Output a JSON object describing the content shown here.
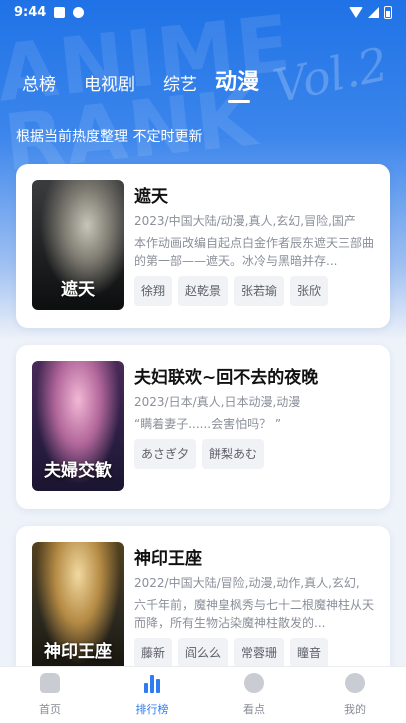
{
  "status_bar": {
    "time": "9:44"
  },
  "hero": {
    "watermark": "ANIME RANK",
    "script": "Vol.2"
  },
  "tabs": [
    {
      "label": "总榜"
    },
    {
      "label": "电视剧"
    },
    {
      "label": "综艺"
    },
    {
      "label": "动漫"
    }
  ],
  "active_tab": "动漫",
  "subtitle": "根据当前热度整理 不定时更新",
  "cards": [
    {
      "poster_title": "遮天",
      "title": "遮天",
      "meta": "2023/中国大陆/动漫,真人,玄幻,冒险,国产",
      "desc": "本作动画改编自起点白金作者辰东遮天三部曲的第一部——遮天。冰冷与黑暗并存...",
      "cast": [
        "徐翔",
        "赵乾景",
        "张若瑜",
        "张欣"
      ]
    },
    {
      "poster_title": "夫婦交歓",
      "title": "夫妇联欢~回不去的夜晚",
      "meta": "2023/日本/真人,日本动漫,动漫",
      "desc": "“瞒着妻子......会害怕吗？ ”",
      "cast": [
        "あさぎ夕",
        "餅梨あむ"
      ]
    },
    {
      "poster_title": "神印王座",
      "title": "神印王座",
      "meta": "2022/中国大陆/冒险,动漫,动作,真人,玄幻,",
      "desc": "六千年前，魔神皇枫秀与七十二根魔神柱从天而降，所有生物沾染魔神柱散发的...",
      "cast": [
        "藤新",
        "阎么么",
        "常蓉珊",
        "瞳音"
      ]
    }
  ],
  "bottom_nav": [
    {
      "label": "首页",
      "icon": "home-icon"
    },
    {
      "label": "排行榜",
      "icon": "ranking-icon"
    },
    {
      "label": "看点",
      "icon": "explore-icon"
    },
    {
      "label": "我的",
      "icon": "profile-icon"
    }
  ],
  "colors": {
    "accent": "#2f7cf0",
    "hero_top": "#1f72e6",
    "background": "#eef2f9"
  }
}
